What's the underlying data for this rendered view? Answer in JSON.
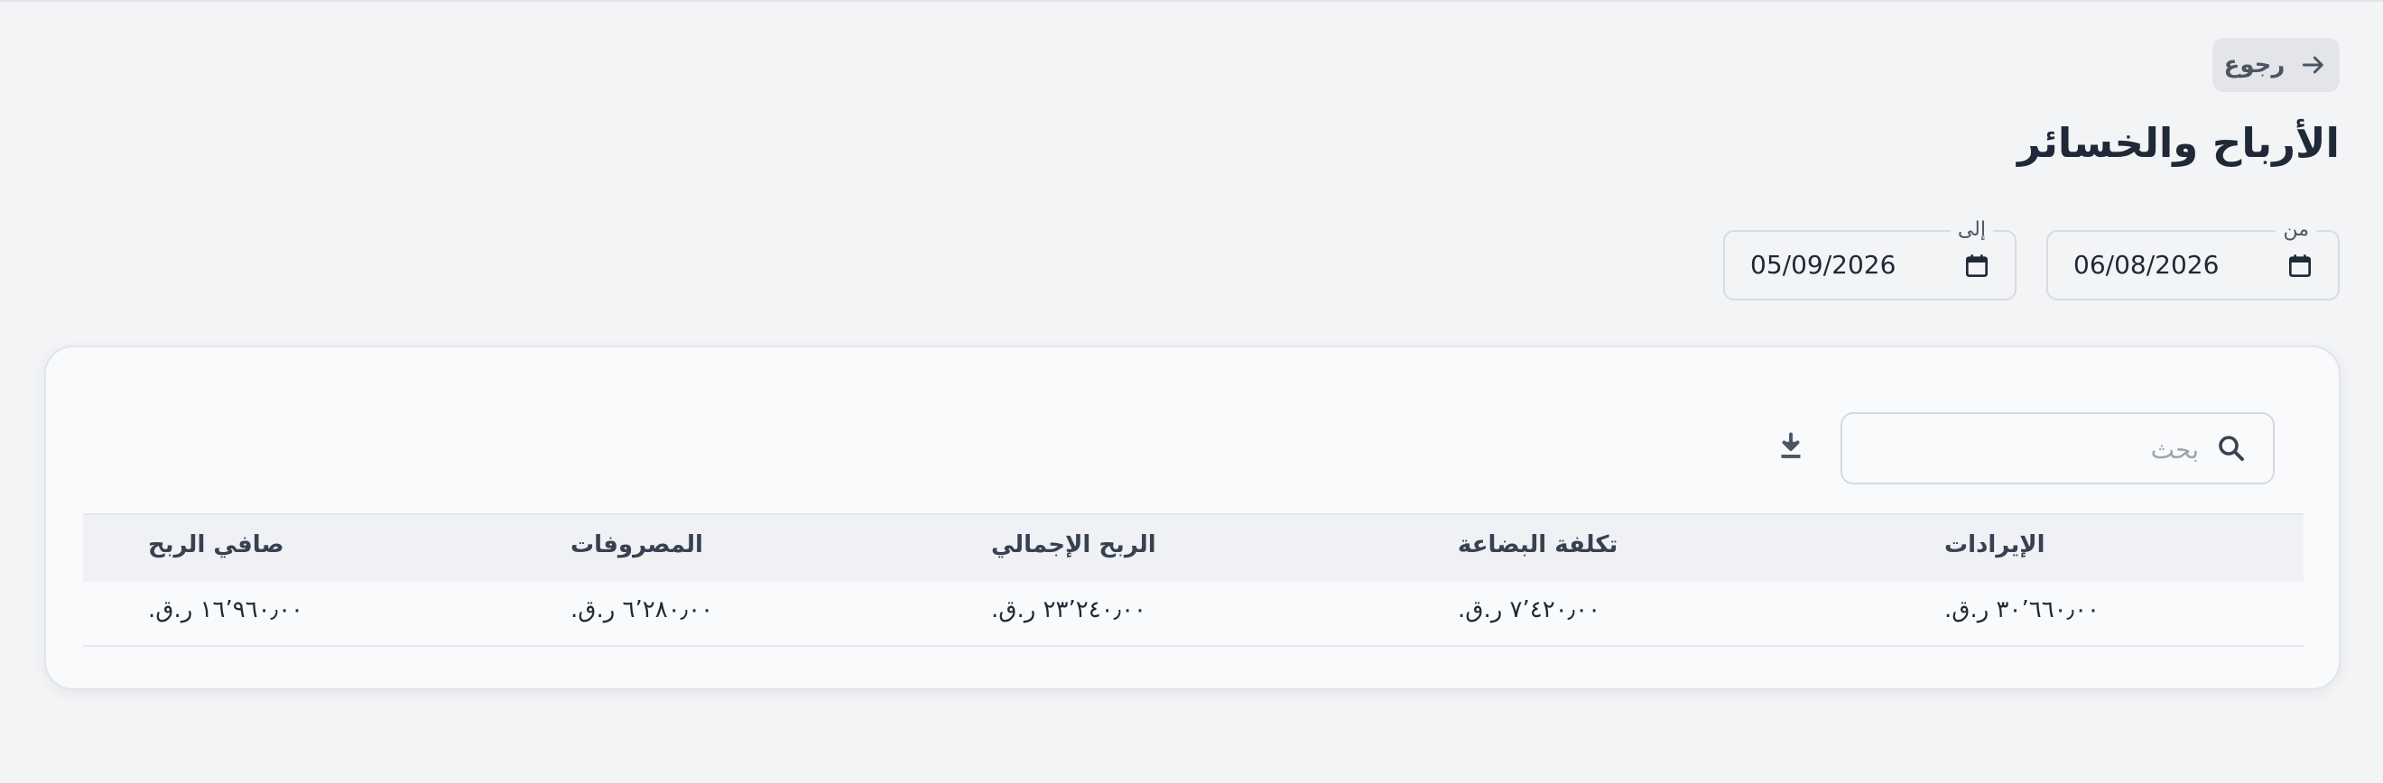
{
  "header": {
    "back_label": "رجوع",
    "title": "الأرباح والخسائر"
  },
  "filters": {
    "from": {
      "label": "من",
      "value": "06/08/2026"
    },
    "to": {
      "label": "إلى",
      "value": "05/09/2026"
    }
  },
  "toolbar": {
    "search_placeholder": "بحث"
  },
  "table": {
    "columns": [
      "الإيرادات",
      "تكلفة البضاعة",
      "الربح الإجمالي",
      "المصروفات",
      "صافي الربح"
    ],
    "rows": [
      [
        "٣٠٬٦٦٠٫٠٠ ر.ق.",
        "٧٬٤٢٠٫٠٠ ر.ق.",
        "٢٣٬٢٤٠٫٠٠ ر.ق.",
        "٦٬٢٨٠٫٠٠ ر.ق.",
        "١٦٬٩٦٠٫٠٠ ر.ق."
      ]
    ]
  },
  "icons": {
    "back": "arrow-right-icon",
    "calendar": "calendar-icon",
    "search": "search-icon",
    "download": "download-icon"
  },
  "colors": {
    "background": "#f3f4f6",
    "card": "#f9fafb",
    "text": "#1f2937",
    "muted": "#4b5563"
  }
}
